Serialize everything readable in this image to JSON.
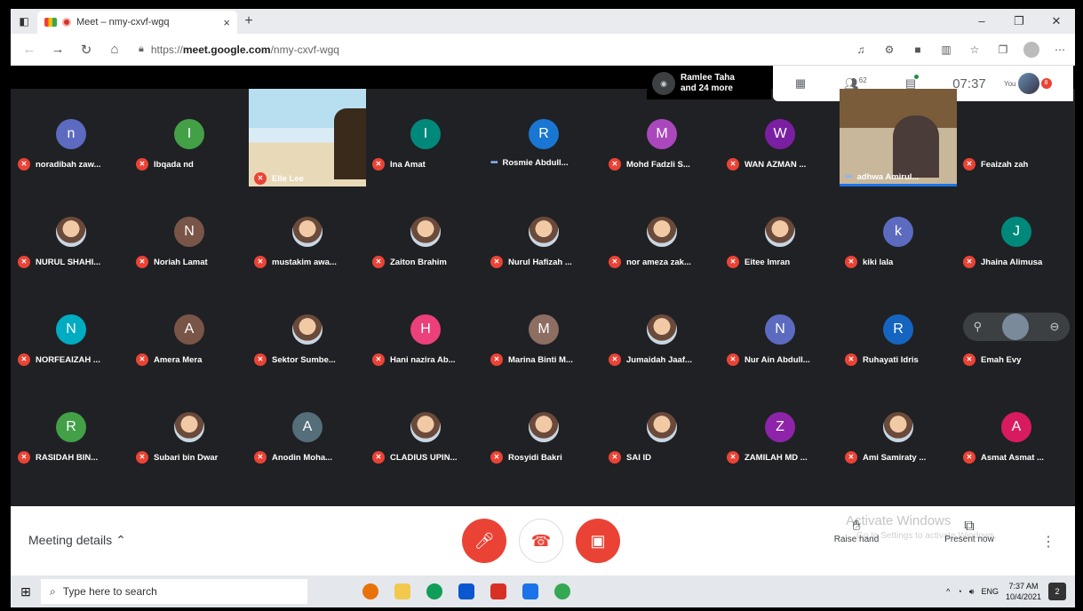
{
  "browser": {
    "tab_title": "Meet – nmy-cxvf-wgq",
    "tab_close": "×",
    "new_tab": "+",
    "url_prefix": "https://",
    "url_domain": "meet.google.com",
    "url_path": "/nmy-cxvf-wgq",
    "window_minimize": "–",
    "window_restore": "❐",
    "window_close": "✕"
  },
  "meet": {
    "presenter_line1": "Ramlee Taha",
    "presenter_line2": "and 24 more",
    "participants_count": "62",
    "clock": "07:37",
    "you_label": "You",
    "notification_count": "8"
  },
  "participants": [
    {
      "name": "noradibah zaw...",
      "initial": "n",
      "color": "#5c6bc0",
      "muted": true
    },
    {
      "name": "Ibqada nd",
      "initial": "I",
      "color": "#43a047",
      "muted": true
    },
    {
      "name": "Elle Lee",
      "initial": "",
      "color": "",
      "muted": true,
      "video": "beach"
    },
    {
      "name": "Ina Amat",
      "initial": "I",
      "color": "#00897b",
      "muted": true
    },
    {
      "name": "Rosmie Abdull...",
      "initial": "R",
      "color": "#1976d2",
      "muted": false
    },
    {
      "name": "Mohd Fadzli S...",
      "initial": "M",
      "color": "#ab47bc",
      "muted": true
    },
    {
      "name": "WAN AZMAN ...",
      "initial": "W",
      "color": "#7b1fa2",
      "muted": true
    },
    {
      "name": "adhwa Amirul...",
      "initial": "",
      "color": "",
      "muted": false,
      "video": "room"
    },
    {
      "name": "Feaizah zah",
      "initial": "",
      "color": "",
      "muted": true,
      "blank": true
    },
    {
      "name": "NURUL SHAHI...",
      "initial": "",
      "color": "#222",
      "muted": true,
      "photo": true
    },
    {
      "name": "Noriah Lamat",
      "initial": "N",
      "color": "#795548",
      "muted": true
    },
    {
      "name": "mustakim awa...",
      "initial": "",
      "color": "",
      "muted": true,
      "photo": true
    },
    {
      "name": "Zaiton Brahim",
      "initial": "",
      "color": "",
      "muted": true,
      "photo": true
    },
    {
      "name": "Nurul Hafizah ...",
      "initial": "",
      "color": "",
      "muted": true,
      "photo": true
    },
    {
      "name": "nor ameza zak...",
      "initial": "",
      "color": "",
      "muted": true,
      "photo": true
    },
    {
      "name": "Eitee Imran",
      "initial": "",
      "color": "",
      "muted": true,
      "photo": true
    },
    {
      "name": "kiki lala",
      "initial": "k",
      "color": "#5c6bc0",
      "muted": true
    },
    {
      "name": "Jhaina Alimusa",
      "initial": "J",
      "color": "#00897b",
      "muted": true
    },
    {
      "name": "NORFEAIZAH ...",
      "initial": "N",
      "color": "#00acc1",
      "muted": true
    },
    {
      "name": "Amera Mera",
      "initial": "A",
      "color": "#795548",
      "muted": true
    },
    {
      "name": "Sektor Sumbe...",
      "initial": "",
      "color": "",
      "muted": true,
      "photo": true
    },
    {
      "name": "Hani nazira Ab...",
      "initial": "H",
      "color": "#ec407a",
      "muted": true
    },
    {
      "name": "Marina Binti M...",
      "initial": "M",
      "color": "#8d6e63",
      "muted": true
    },
    {
      "name": "Jumaidah Jaaf...",
      "initial": "",
      "color": "",
      "muted": true,
      "photo": true
    },
    {
      "name": "Nur Ain Abdull...",
      "initial": "N",
      "color": "#5c6bc0",
      "muted": true
    },
    {
      "name": "Ruhayati Idris",
      "initial": "R",
      "color": "#1565c0",
      "muted": true
    },
    {
      "name": "Emah Evy",
      "initial": "",
      "color": "",
      "muted": true,
      "pinctrl": true
    },
    {
      "name": "RASIDAH BIN...",
      "initial": "R",
      "color": "#43a047",
      "muted": true
    },
    {
      "name": "Subari bin Dwar",
      "initial": "",
      "color": "",
      "muted": true,
      "photo": true
    },
    {
      "name": "Anodin Moha...",
      "initial": "A",
      "color": "#546e7a",
      "muted": true
    },
    {
      "name": "CLADIUS UPIN...",
      "initial": "",
      "color": "",
      "muted": true,
      "photo": true
    },
    {
      "name": "Rosyidi Bakri",
      "initial": "",
      "color": "",
      "muted": true,
      "photo": true
    },
    {
      "name": "SAI ID",
      "initial": "",
      "color": "",
      "muted": true,
      "photo": true
    },
    {
      "name": "ZAMILAH MD ...",
      "initial": "Z",
      "color": "#8e24aa",
      "muted": true
    },
    {
      "name": "Ami Samiraty ...",
      "initial": "",
      "color": "",
      "muted": true,
      "photo": true
    },
    {
      "name": "Asmat Asmat ...",
      "initial": "A",
      "color": "#d81b60",
      "muted": true
    }
  ],
  "bottom": {
    "meeting_details": "Meeting details",
    "raise_hand": "Raise hand",
    "present_now": "Present now",
    "watermark_title": "Activate Windows",
    "watermark_sub": "Go to Settings to activate Windows."
  },
  "taskbar": {
    "search_placeholder": "Type here to search",
    "time": "7:37 AM",
    "date": "10/4/2021",
    "lang": "ENG",
    "notifications": "2"
  },
  "colors": {
    "meet_bg": "#202124",
    "end_call": "#ea4335",
    "accent_blue": "#1a73e8"
  }
}
